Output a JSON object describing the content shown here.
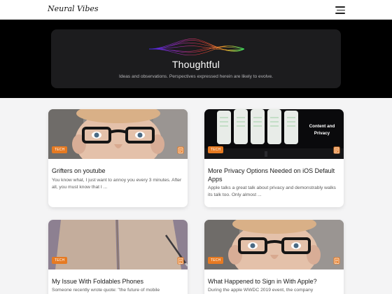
{
  "header": {
    "logo": "Neural Vibes",
    "menu_icon": "hamburger-menu-icon"
  },
  "hero": {
    "title": "Thoughtful",
    "subtitle": "Ideas and observations. Perspectives expressed herein are likely to evolve."
  },
  "posts": [
    {
      "badge": "TECH",
      "title": "Grifters on youtube",
      "excerpt": "You know what, I just want to annoy you every 3 minutes. After all, you must know that I ...",
      "image": "boy-with-glasses-photo"
    },
    {
      "badge": "TECH",
      "title": "More Privacy Options Needed on iOS Default Apps",
      "excerpt": "Apple talks a great talk about privacy and demonstrably walks its talk too. Only almost ...",
      "image": "wwdc-privacy-stage-photo",
      "image_text": "Content and Privacy"
    },
    {
      "badge": "TECH",
      "title": "My Issue With Foldables Phones",
      "excerpt": "Someone recently wrote quote: \"the future of mobile",
      "image": "open-notebook-photo"
    },
    {
      "badge": "TECH",
      "title": "What Happened to Sign in With Apple?",
      "excerpt": "During the apple WWDC 2019 event, the company",
      "image": "boy-with-glasses-photo"
    }
  ],
  "colors": {
    "accent": "#e67a22",
    "hero_bg": "#000000",
    "hero_card": "#1c1c1e"
  }
}
